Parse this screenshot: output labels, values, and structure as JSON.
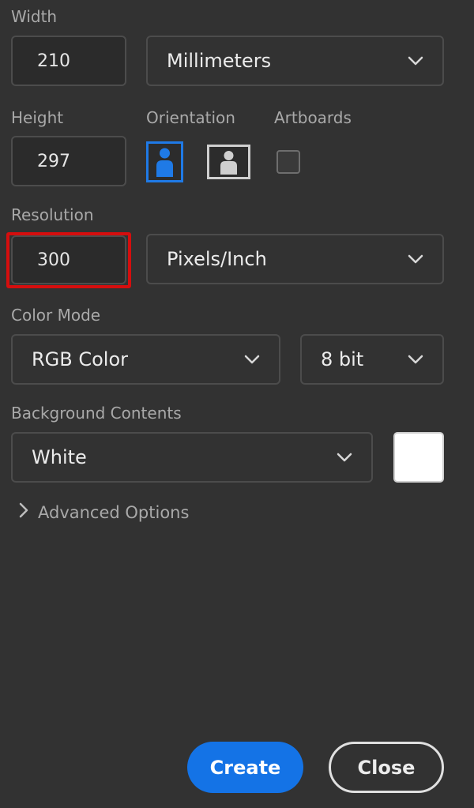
{
  "width": {
    "label": "Width",
    "value": "210",
    "unit": "Millimeters"
  },
  "height": {
    "label": "Height",
    "value": "297"
  },
  "orientation": {
    "label": "Orientation",
    "selected": "portrait"
  },
  "artboards": {
    "label": "Artboards",
    "checked": false
  },
  "resolution": {
    "label": "Resolution",
    "value": "300",
    "unit": "Pixels/Inch"
  },
  "color_mode": {
    "label": "Color Mode",
    "mode": "RGB Color",
    "depth": "8 bit"
  },
  "background": {
    "label": "Background Contents",
    "value": "White",
    "swatch_color": "#ffffff"
  },
  "advanced": {
    "label": "Advanced Options"
  },
  "buttons": {
    "create": "Create",
    "close": "Close"
  },
  "colors": {
    "accent": "#1473e6",
    "highlight": "#d50e0e",
    "panel": "#323232"
  }
}
